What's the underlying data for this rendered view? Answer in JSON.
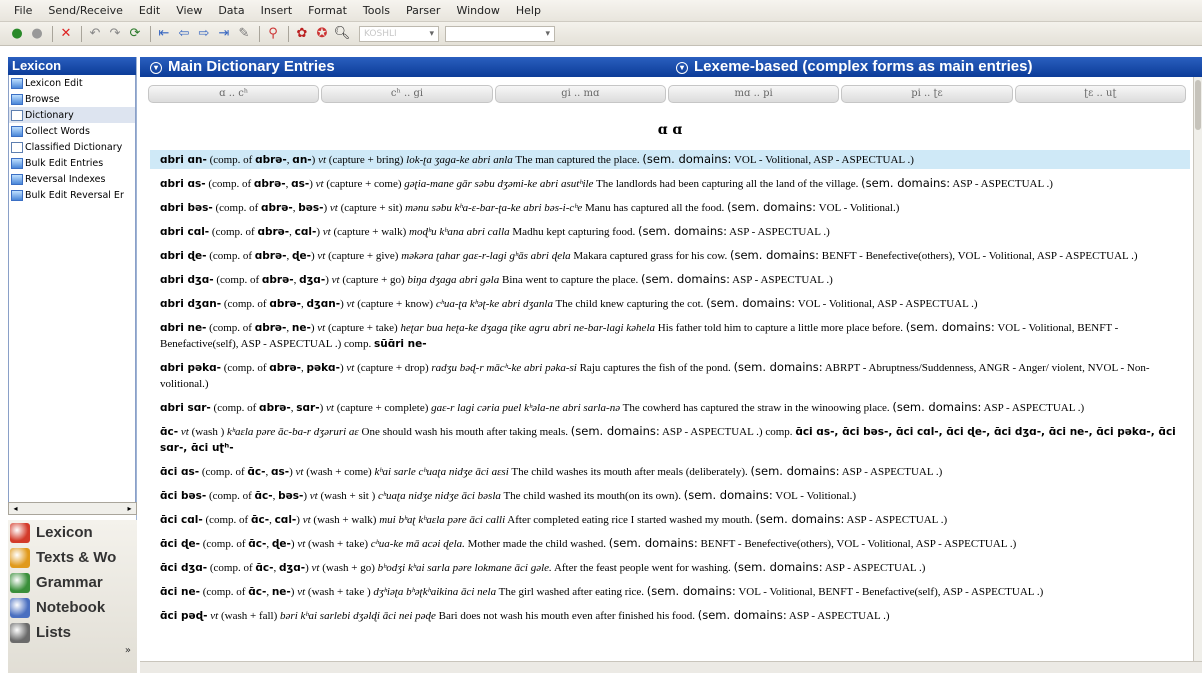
{
  "menu": [
    "File",
    "Send/Receive",
    "Edit",
    "View",
    "Data",
    "Insert",
    "Format",
    "Tools",
    "Parser",
    "Window",
    "Help"
  ],
  "toolbar": {
    "combo1": "KOSHLI",
    "combo2": ""
  },
  "sidebar": {
    "title": "Lexicon",
    "tools": [
      {
        "label": "Lexicon Edit",
        "icon": "grid-icon"
      },
      {
        "label": "Browse",
        "icon": "grid-icon"
      },
      {
        "label": "Dictionary",
        "icon": "document-icon"
      },
      {
        "label": "Collect Words",
        "icon": "grid-icon"
      },
      {
        "label": "Classified Dictionary",
        "icon": "document-icon"
      },
      {
        "label": "Bulk Edit Entries",
        "icon": "grid-icon"
      },
      {
        "label": "Reversal Indexes",
        "icon": "grid-icon"
      },
      {
        "label": "Bulk Edit Reversal Er",
        "icon": "grid-icon"
      }
    ],
    "areas": [
      {
        "label": "Lexicon",
        "color": "#d33b2a"
      },
      {
        "label": "Texts & Wo",
        "color": "#e09a1c"
      },
      {
        "label": "Grammar",
        "color": "#3a8f3a"
      },
      {
        "label": "Notebook",
        "color": "#4a6fc0"
      },
      {
        "label": "Lists",
        "color": "#6b6b6b"
      }
    ],
    "more": "»"
  },
  "main": {
    "title": "Main Dictionary Entries",
    "secondary_title": "Lexeme-based (complex forms as main entries)",
    "tabs": [
      "ɑ .. cʰ",
      "cʰ .. gi",
      "gi .. mɑ",
      "mɑ .. pi",
      "pi .. ʈɛ",
      "ʈɛ .. uʈ"
    ],
    "letter_head": "ɑ ɑ"
  },
  "entries": [
    {
      "hw": "ɑbri ɑn-",
      "comp": "(comp. of ",
      "c1": "ɑbrə-",
      "c2": "ɑn-",
      "pos": "vt",
      "gloss": "(capture + bring)",
      "ex": "lok-ʈa ʒaga-ke abri anla",
      "tr": "The man captured the place.",
      "sd": "(sem. domains:",
      "sdv": "VOL - Volitional, ASP - ASPECTUAL .)"
    },
    {
      "hw": "ɑbri ɑs-",
      "comp": "(comp. of ",
      "c1": "ɑbrə-",
      "c2": "ɑs-",
      "pos": "vt",
      "gloss": "(capture + come)",
      "ex": "gəʈia-mane gār səbu dʒəmi-ke abri asutʰile",
      "tr": "The landlords had been capturing all the land of the village.",
      "sd": "(sem. domains:",
      "sdv": "ASP - ASPECTUAL .)"
    },
    {
      "hw": "ɑbri bəs-",
      "comp": "(comp. of ",
      "c1": "ɑbrə-",
      "c2": "bəs-",
      "pos": "vt",
      "gloss": "(capture + sit)",
      "ex": "mənu səbu kʰa-ɛ-bar-ʈa-ke abri bəs-i-cʰe",
      "tr": "Manu has captured all the food.",
      "sd": "(sem. domains:",
      "sdv": "VOL - Volitional.)"
    },
    {
      "hw": "ɑbri cɑl-",
      "comp": "(comp. of ",
      "c1": "ɑbrə-",
      "c2": "cɑl-",
      "pos": "vt",
      "gloss": "(capture + walk)",
      "ex": "moɖʰu kʰana abri calla",
      "tr": "Madhu kept capturing food.",
      "sd": "(sem. domains:",
      "sdv": "ASP - ASPECTUAL .)"
    },
    {
      "hw": "ɑbri ɖe-",
      "comp": "(comp. of ",
      "c1": "ɑbrə-",
      "c2": "ɖe-",
      "pos": "vt",
      "gloss": "(capture + give)",
      "ex": "məkəra ʈahar gaɛ-r-lagi gʰās abri ɖela",
      "tr": "Makara captured grass for his cow.",
      "sd": "(sem. domains:",
      "sdv": "BENFT - Benefective(others), VOL - Volitional, ASP - ASPECTUAL .)"
    },
    {
      "hw": "ɑbri dʒɑ-",
      "comp": "(comp. of ",
      "c1": "ɑbrə-",
      "c2": "dʒɑ-",
      "pos": "vt",
      "gloss": "(capture + go)",
      "ex": "biŋa dʒaga abri gəla",
      "tr": "Bina went to capture the place.",
      "sd": "(sem. domains:",
      "sdv": "ASP - ASPECTUAL .)"
    },
    {
      "hw": "ɑbri dʒɑn-",
      "comp": "(comp. of ",
      "c1": "ɑbrə-",
      "c2": "dʒɑn-",
      "pos": "vt",
      "gloss": "(capture + know)",
      "ex": "cʰua-ʈa kʰəʈ-ke abri dʒanla",
      "tr": "The child knew capturing the cot.",
      "sd": "(sem. domains:",
      "sdv": "VOL - Volitional, ASP - ASPECTUAL .)"
    },
    {
      "hw": "ɑbri ne-",
      "comp": "(comp. of ",
      "c1": "ɑbrə-",
      "c2": "ne-",
      "pos": "vt",
      "gloss": "(capture + take)",
      "ex": "heʈar bua heʈa-ke dʒaga ʈike agru abri ne-bar-lagi kəhela",
      "tr": "His father told him to capture a little more place before.",
      "sd": "(sem. domains:",
      "sdv": "VOL - Volitional, BENFT - Benefactive(self), ASP - ASPECTUAL .)",
      "extra": "comp. ",
      "extra2": "sūɑ̄ri ne-"
    },
    {
      "hw": "ɑbri pəkɑ-",
      "comp": "(comp. of ",
      "c1": "ɑbrə-",
      "c2": "pəkɑ-",
      "pos": "vt",
      "gloss": "(capture + drop)",
      "ex": "radʒu bəɖ-r mācʰ-ke abri pəka-si",
      "tr": "Raju captures the fish of the pond.",
      "sd": "(sem. domains:",
      "sdv": "ABRPT - Abruptness/Suddenness, ANGR - Anger/ violent, NVOL - Non-volitional.)"
    },
    {
      "hw": "ɑbri sɑr-",
      "comp": "(comp. of ",
      "c1": "ɑbrə-",
      "c2": "sɑr-",
      "pos": "vt",
      "gloss": "(capture + complete)",
      "ex": "gaɛ-r lagi cəria puel kʰəla-ne abri sarla-nə",
      "tr": "The cowherd has captured the straw in the winoowing place.",
      "sd": "(sem. domains:",
      "sdv": "ASP - ASPECTUAL .)"
    },
    {
      "hw": "ɑ̄c-",
      "comp": "",
      "c1": "",
      "c2": "",
      "pos": "vt",
      "gloss": "(wash )",
      "ex": "kʰaɛla pəre āc-ba-r dʒəruri aɛ",
      "tr": "One should wash his mouth after  taking meals.",
      "sd": "(sem. domains:",
      "sdv": "ASP - ASPECTUAL .)",
      "extra": "comp. ",
      "extra2": "ɑ̄ci ɑs-,  ɑ̄ci bəs-,  ɑ̄ci cɑl-,  ɑ̄ci ɖe-,  ɑ̄ci dʒɑ-,  ɑ̄ci ne-,  ɑ̄ci pəkɑ-,  ɑ̄ci sɑr-,  ɑ̄ci uʈʰ-"
    },
    {
      "hw": "ɑ̄ci ɑs-",
      "comp": "(comp. of ",
      "c1": "ɑ̄c-",
      "c2": "ɑs-",
      "pos": "vt",
      "gloss": "(wash + come)",
      "ex": "kʰai sarle cʰuaʈa nidʒe āci aɛsi",
      "tr": "The child washes its mouth after meals (deliberately).",
      "sd": "(sem. domains:",
      "sdv": "ASP - ASPECTUAL .)"
    },
    {
      "hw": "ɑ̄ci bəs-",
      "comp": "(comp. of ",
      "c1": "ɑ̄c-",
      "c2": "bəs-",
      "pos": "vt",
      "gloss": "(wash + sit )",
      "ex": "cʰuaʈa nidʒe nidʒe āci bəsla",
      "tr": "The child washed its mouth(on its own).",
      "sd": "(sem. domains:",
      "sdv": "VOL - Volitional.)"
    },
    {
      "hw": "ɑ̄ci cɑl-",
      "comp": "(comp. of ",
      "c1": "ɑ̄c-",
      "c2": "cɑl-",
      "pos": "vt",
      "gloss": "(wash + walk)",
      "ex": "mui bʰaʈ kʰaɛla pəre āci calli",
      "tr": "After completed eating rice I started washed  my mouth.",
      "sd": "(sem. domains:",
      "sdv": "ASP - ASPECTUAL .)"
    },
    {
      "hw": "ɑ̄ci ɖe-",
      "comp": "(comp. of ",
      "c1": "ɑ̄c-",
      "c2": "ɖe-",
      "pos": "vt",
      "gloss": "(wash + take)",
      "ex": "cʰua-ke mā acəi ɖela.",
      "tr": "Mother made the child washed.",
      "sd": "(sem. domains:",
      "sdv": "BENFT - Benefective(others), VOL - Volitional, ASP - ASPECTUAL .)"
    },
    {
      "hw": "ɑ̄ci dʒɑ-",
      "comp": "(comp. of ",
      "c1": "ɑ̄c-",
      "c2": "dʒɑ-",
      "pos": "vt",
      "gloss": "(wash + go)",
      "ex": "bʰodʒi kʰai sarla pəre lokmane āci gəle.",
      "tr": "After the feast people went for washing.",
      "sd": "(sem. domains:",
      "sdv": "ASP - ASPECTUAL .)"
    },
    {
      "hw": "ɑ̄ci ne-",
      "comp": "(comp. of ",
      "c1": "ɑ̄c-",
      "c2": "ne-",
      "pos": "vt",
      "gloss": "(wash + take )",
      "ex": "dʒʰiəʈa bʰəʈkʰaikina āci nela",
      "tr": "The girl washed after eating rice.",
      "sd": "(sem. domains:",
      "sdv": "VOL - Volitional, BENFT - Benefactive(self), ASP - ASPECTUAL .)"
    },
    {
      "hw": "ɑ̄ci pəɖ-",
      "comp": "",
      "c1": "",
      "c2": "",
      "pos": "vt",
      "gloss": "(wash +  fall)",
      "ex": "bəri kʰai sarlebi dʒəlɖi āci nei pəɖe",
      "tr": "Bari does not wash his mouth even after finished his food.",
      "sd": "(sem. domains:",
      "sdv": "ASP - ASPECTUAL .)"
    }
  ]
}
